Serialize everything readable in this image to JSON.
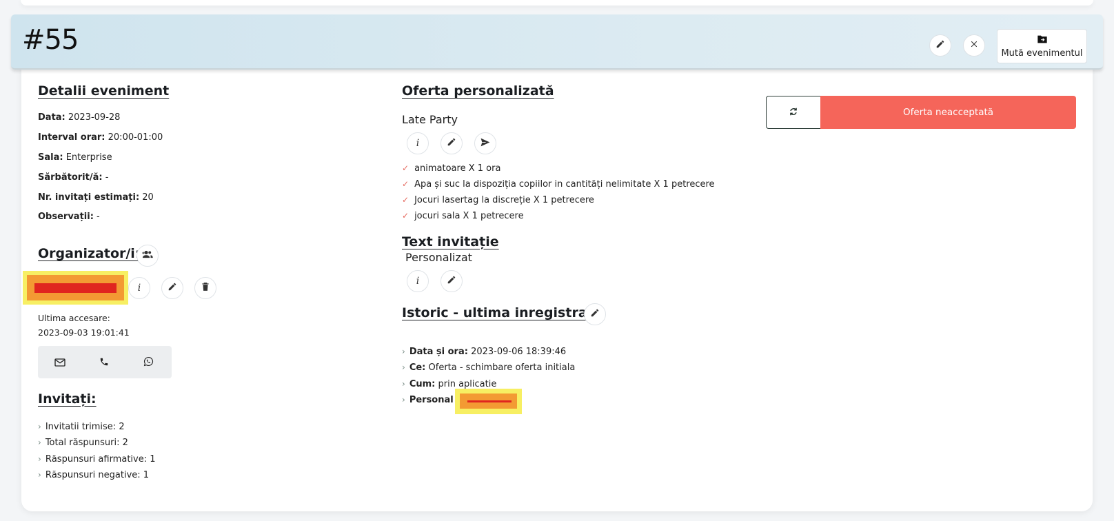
{
  "header": {
    "event_number": "#55",
    "move_event_label": "Mută evenimentul"
  },
  "details": {
    "title": "Detalii eveniment",
    "rows": [
      {
        "label": "Data:",
        "value": "2023-09-28"
      },
      {
        "label": "Interval orar:",
        "value": "20:00-01:00"
      },
      {
        "label": "Sala:",
        "value": "Enterprise"
      },
      {
        "label": "Sărbătorit/ă:",
        "value": "-"
      },
      {
        "label": "Nr. invitați estimați:",
        "value": "20"
      },
      {
        "label": "Observații:",
        "value": "-"
      }
    ]
  },
  "organizers": {
    "title": "Organizator/i:",
    "last_access_label": "Ultima accesare:",
    "last_access_value": "2023-09-03 19:01:41"
  },
  "guests": {
    "title": "Invitați:",
    "items": [
      "Invitatii trimise: 2",
      "Total răspunsuri: 2",
      "Răspunsuri afirmative: 1",
      "Răspunsuri negative: 1"
    ]
  },
  "offer": {
    "title": "Oferta personalizată",
    "name": "Late Party",
    "items": [
      "animatoare X 1 ora",
      "Apa și suc la dispoziția copiilor in cantități nelimitate X 1 petrecere",
      "Jocuri lasertag la discreție X 1 petrecere",
      "jocuri sala X 1 petrecere"
    ],
    "status_label": "Oferta neacceptată"
  },
  "invitation_text": {
    "title": "Text invitație",
    "value": "Personalizat"
  },
  "history": {
    "title": "Istoric - ultima inregistrare",
    "rows": [
      {
        "label": "Data și ora:",
        "value": "2023-09-06 18:39:46"
      },
      {
        "label": "Ce:",
        "value": "Oferta - schimbare oferta initiala"
      },
      {
        "label": "Cum:",
        "value": "prin aplicatie"
      },
      {
        "label": "Personal :",
        "value": ""
      }
    ]
  },
  "colors": {
    "accent_red": "#f5655a",
    "header_bg": "#d4e8f0"
  }
}
